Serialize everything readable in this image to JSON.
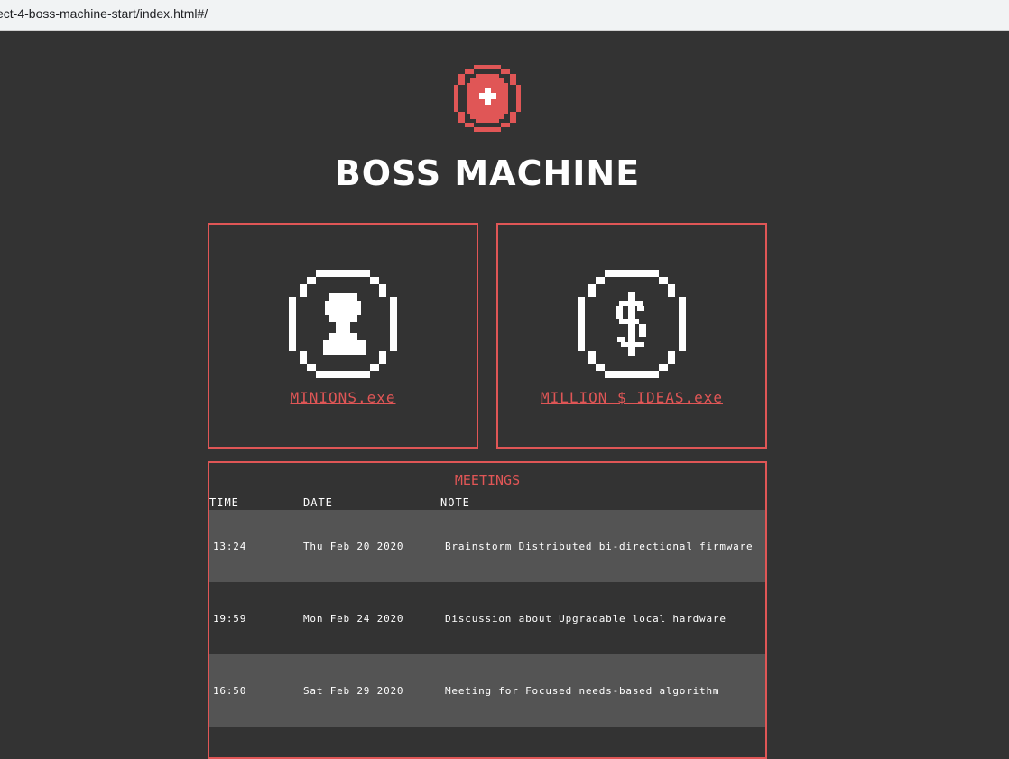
{
  "browser": {
    "url": "ect-4-boss-machine-start/index.html#/"
  },
  "header": {
    "title": "BOSS MACHINE"
  },
  "cards": [
    {
      "label": "MINIONS.exe",
      "icon": "minion-icon"
    },
    {
      "label": "MILLION $ IDEAS.exe",
      "icon": "dollar-icon"
    }
  ],
  "meetings": {
    "title": "MEETINGS",
    "columns": [
      "TIME",
      "DATE",
      "NOTE"
    ],
    "rows": [
      {
        "time": "13:24",
        "date": "Thu Feb 20 2020",
        "note": "Brainstorm Distributed bi-directional firmware"
      },
      {
        "time": "19:59",
        "date": "Mon Feb 24 2020",
        "note": "Discussion about Upgradable local hardware"
      },
      {
        "time": "16:50",
        "date": "Sat Feb 29 2020",
        "note": "Meeting for Focused needs-based algorithm"
      }
    ]
  },
  "colors": {
    "accent": "#e05656",
    "background": "#333333",
    "row_shade": "#545454"
  }
}
